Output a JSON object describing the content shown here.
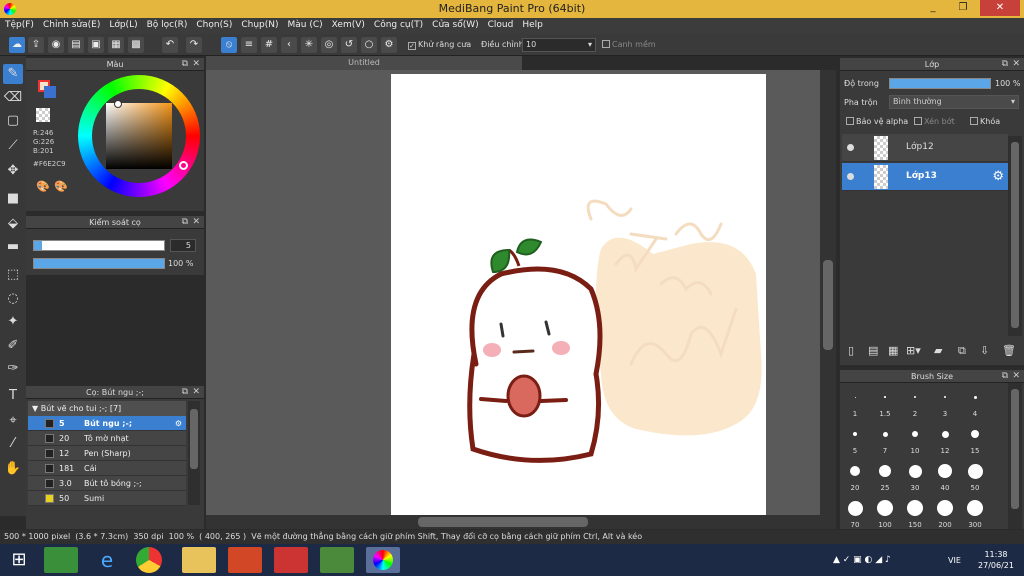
{
  "window": {
    "title": "MediBang Paint Pro (64bit)",
    "minimize": "_",
    "maximize": "❐",
    "close": "✕"
  },
  "menu": [
    "Tệp(F)",
    "Chỉnh sửa(E)",
    "Lớp(L)",
    "Bộ lọc(R)",
    "Chọn(S)",
    "Chụp(N)",
    "Màu (C)",
    "Xem(V)",
    "Công cụ(T)",
    "Cửa sổ(W)",
    "Cloud",
    "Help"
  ],
  "toolbar": {
    "antialias_label": "Khử răng cưa",
    "stabilizer_label": "Điều chỉnh",
    "stabilizer_value": "10",
    "snap_label": "Canh mềm"
  },
  "color_panel": {
    "title": "Màu",
    "r": "R:246",
    "g": "G:226",
    "b": "B:201",
    "hex": "#F6E2C9",
    "primary": "#F6E2C9"
  },
  "brush_control": {
    "title": "Kiểm soát cọ",
    "size": "5",
    "opacity": "100 %",
    "size_frac": 0.06,
    "opacity_frac": 1.0
  },
  "brush_panel": {
    "title": "Cọ: Bút ngu ;-;",
    "group": "Bút vẽ cho tui ;-; [7]",
    "items": [
      {
        "size": "5",
        "name": "Bút ngu ;-;",
        "color": "#222222",
        "selected": true
      },
      {
        "size": "20",
        "name": "Tô mờ nhạt",
        "color": "#222222"
      },
      {
        "size": "12",
        "name": "Pen (Sharp)",
        "color": "#222222"
      },
      {
        "size": "181",
        "name": "Cái",
        "color": "#222222"
      },
      {
        "size": "3.0",
        "name": "Bút tô bóng ;-;",
        "color": "#222222"
      },
      {
        "size": "50",
        "name": "Sumi",
        "color": "#e8d21c"
      }
    ]
  },
  "document": {
    "tab": "Untitled"
  },
  "layer_panel": {
    "title": "Lớp",
    "opacity_label": "Độ trong",
    "opacity_value": "100 %",
    "blend_label": "Pha trộn",
    "blend_value": "Bình thường",
    "protect_alpha": "Bảo vệ alpha",
    "clipping": "Xén bớt",
    "lock": "Khóa",
    "layers": [
      {
        "name": "Lớp12",
        "selected": false
      },
      {
        "name": "Lớp13",
        "selected": true
      }
    ]
  },
  "brush_size_panel": {
    "title": "Brush Size",
    "sizes": [
      "1",
      "1.5",
      "2",
      "3",
      "4",
      "5",
      "7",
      "10",
      "12",
      "15",
      "20",
      "25",
      "30",
      "40",
      "50",
      "70",
      "100",
      "150",
      "200",
      "300"
    ]
  },
  "status": {
    "size": "500 * 1000 pixel",
    "cm": "(3.6 * 7.3cm)",
    "dpi": "350 dpi",
    "zoom": "100 %",
    "coords": "( 400, 265 )",
    "hint": "Vẽ một đường thẳng bằng cách giữ phím Shift, Thay đổi cỡ cọ bằng cách giữ phím Ctrl, Alt và kéo"
  },
  "taskbar": {
    "lang": "VIE",
    "time": "11:38",
    "date": "27/06/21"
  }
}
